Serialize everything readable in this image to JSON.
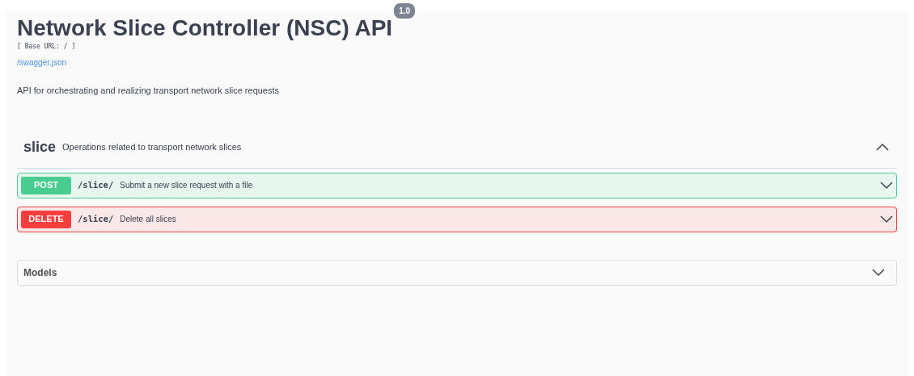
{
  "info": {
    "title": "Network Slice Controller (NSC) API",
    "version": "1.0",
    "base_url": "[ Base URL: / ]",
    "spec_link": "/swagger.json",
    "description": "API for orchestrating and realizing transport network slice requests"
  },
  "tag": {
    "name": "slice",
    "description": "Operations related to transport network slices",
    "expanded": true
  },
  "operations": [
    {
      "kind": "post",
      "method": "POST",
      "path": "/slice/",
      "summary": "Submit a new slice request with a file",
      "expanded": false
    },
    {
      "kind": "delete",
      "method": "DELETE",
      "path": "/slice/",
      "summary": "Delete all slices",
      "expanded": false
    }
  ],
  "models": {
    "title": "Models",
    "expanded": false
  }
}
